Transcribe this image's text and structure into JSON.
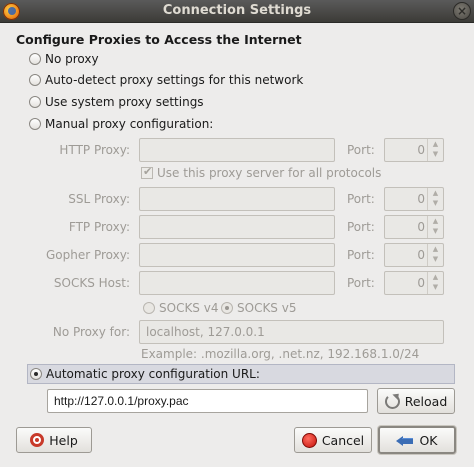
{
  "window": {
    "title": "Connection Settings",
    "close_glyph": "×",
    "icon": "firefox-icon"
  },
  "heading": "Configure Proxies to Access the Internet",
  "options": {
    "no_proxy": "No proxy",
    "auto_detect": "Auto-detect proxy settings for this network",
    "system": "Use system proxy settings",
    "manual": "Manual proxy configuration:",
    "auto_url": "Automatic proxy configuration URL:"
  },
  "manual": {
    "http_label": "HTTP Proxy:",
    "same_proxy_label": "Use this proxy server for all protocols",
    "ssl_label": "SSL Proxy:",
    "ftp_label": "FTP Proxy:",
    "gopher_label": "Gopher Proxy:",
    "socks_label": "SOCKS Host:",
    "port_label": "Port:",
    "port_value": "0",
    "socks_v4": "SOCKS v4",
    "socks_v5": "SOCKS v5",
    "no_proxy_label": "No Proxy for:",
    "no_proxy_value": "localhost, 127.0.0.1",
    "example": "Example: .mozilla.org, .net.nz, 192.168.1.0/24"
  },
  "auto_config": {
    "url_value": "http://127.0.0.1/proxy.pac",
    "reload": "Reload"
  },
  "buttons": {
    "help": "Help",
    "cancel": "Cancel",
    "ok": "OK"
  },
  "selected_option": "auto_url"
}
